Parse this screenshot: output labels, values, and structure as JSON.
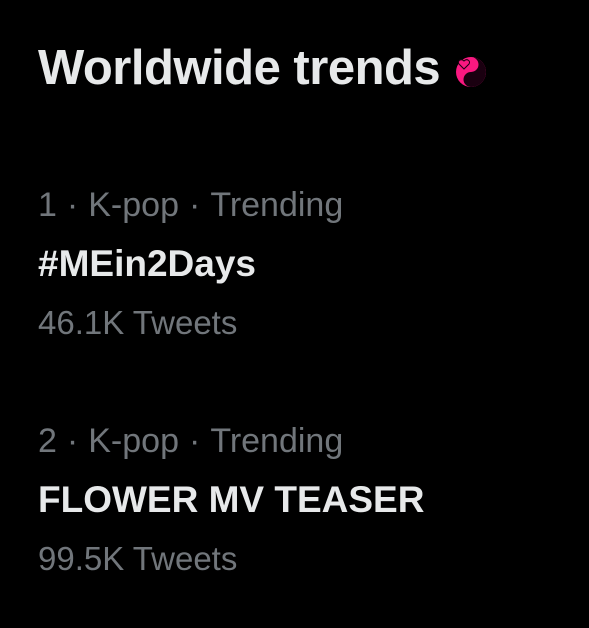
{
  "header": {
    "title": "Worldwide trends",
    "emoji_icon": "heart-yin-yang-icon",
    "emoji_color": "#f91880"
  },
  "trends": [
    {
      "rank": "1",
      "category": "K-pop",
      "context": "Trending",
      "name": "#MEin2Days",
      "count": "46.1K Tweets"
    },
    {
      "rank": "2",
      "category": "K-pop",
      "context": "Trending",
      "name": "FLOWER MV TEASER",
      "count": "99.5K Tweets"
    }
  ],
  "separator": "·",
  "colors": {
    "background": "#000000",
    "primary_text": "#e7e9ea",
    "secondary_text": "#71767b",
    "accent": "#f91880"
  }
}
